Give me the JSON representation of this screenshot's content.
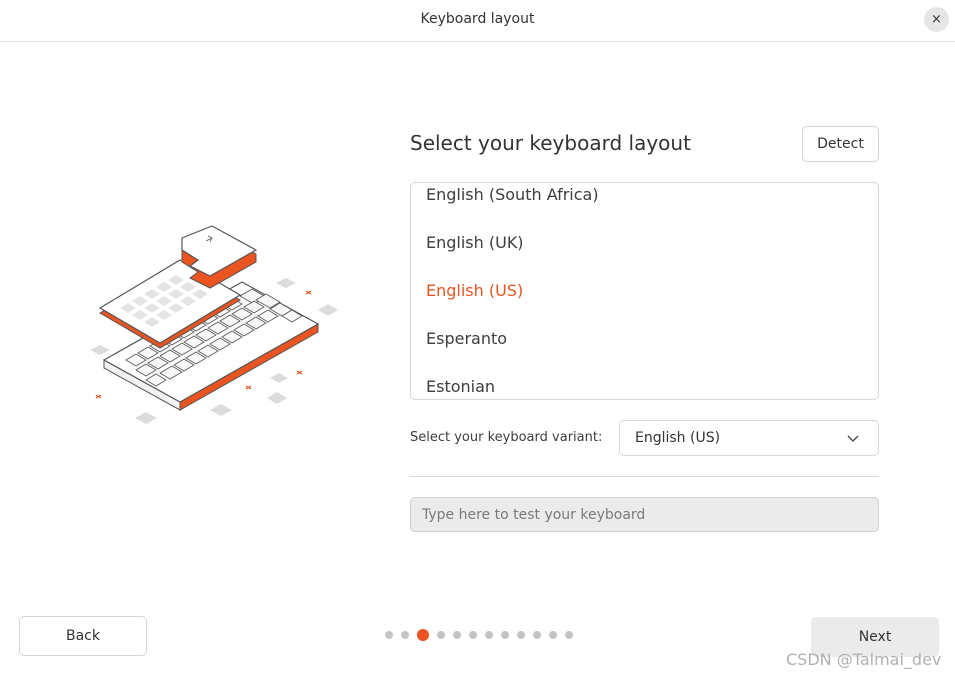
{
  "window": {
    "title": "Keyboard layout",
    "close_icon": "×"
  },
  "main": {
    "heading": "Select your keyboard layout",
    "detect_label": "Detect",
    "layouts": [
      {
        "label": "English (South Africa)",
        "selected": false
      },
      {
        "label": "English (UK)",
        "selected": false
      },
      {
        "label": "English (US)",
        "selected": true
      },
      {
        "label": "Esperanto",
        "selected": false
      },
      {
        "label": "Estonian",
        "selected": false
      }
    ],
    "variant_label": "Select your keyboard variant:",
    "variant_value": "English (US)",
    "test_placeholder": "Type here to test your keyboard"
  },
  "footer": {
    "back_label": "Back",
    "next_label": "Next",
    "page_current": 3,
    "page_total": 12
  },
  "watermark": "CSDN @Talmai_dev",
  "colors": {
    "accent": "#e95420",
    "dot_inactive": "#c4c4c4"
  }
}
